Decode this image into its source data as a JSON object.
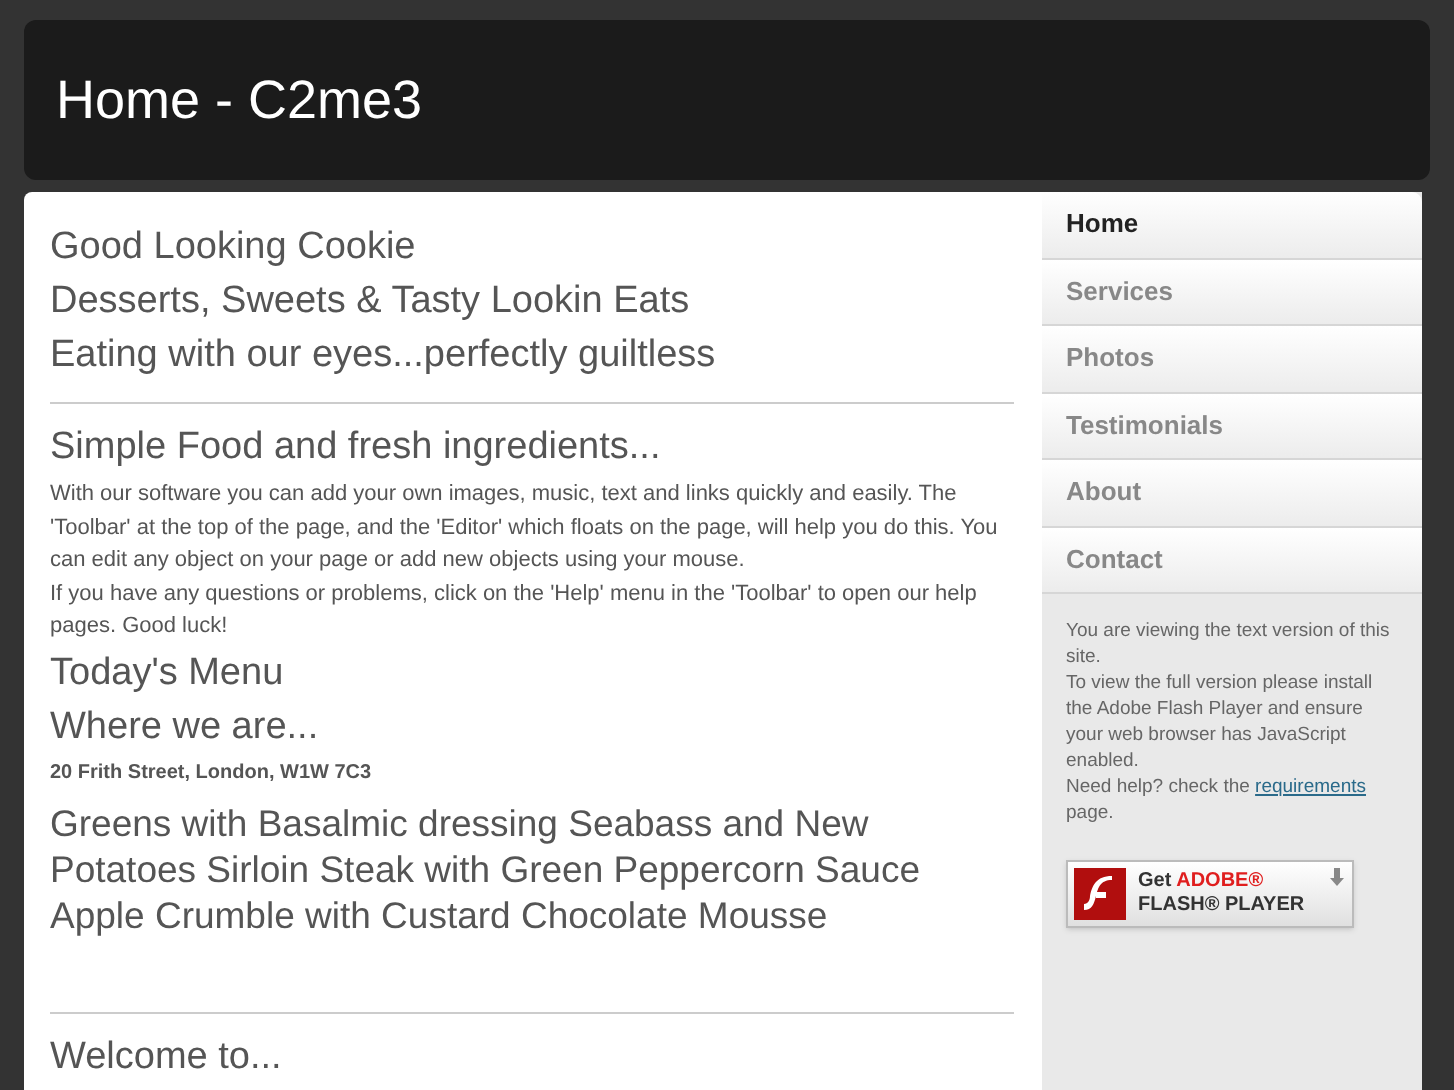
{
  "header": {
    "title": "Home - C2me3"
  },
  "content": {
    "intro_lines": [
      "Good Looking Cookie",
      "Desserts, Sweets & Tasty Lookin Eats",
      "Eating with our eyes...perfectly guiltless"
    ],
    "section_heading": "Simple Food and fresh ingredients...",
    "paragraphs": [
      "With our software you can add your own images, music, text and links quickly and easily. The 'Toolbar' at the top of the page, and the 'Editor' which floats on the page, will help you do this. You can edit any object on your page or add new objects using your mouse.",
      "If you have any questions or problems, click on the 'Help' menu in the 'Toolbar' to open our help pages. Good luck!"
    ],
    "menu_heading": "Today's Menu",
    "location_heading": "Where we are...",
    "address": "20 Frith Street, London, W1W 7C3",
    "menu_text": "Greens with Basalmic dressing Seabass and New Potatoes Sirloin Steak with Green Peppercorn Sauce Apple Crumble with Custard Chocolate Mousse",
    "welcome_heading": "Welcome to..."
  },
  "nav": [
    {
      "label": "Home",
      "selected": true
    },
    {
      "label": "Services",
      "selected": false
    },
    {
      "label": "Photos",
      "selected": false
    },
    {
      "label": "Testimonials",
      "selected": false
    },
    {
      "label": "About",
      "selected": false
    },
    {
      "label": "Contact",
      "selected": false
    }
  ],
  "sidebar": {
    "notice_lines": [
      "You are viewing the text version of this site.",
      "To view the full version please install the Adobe Flash Player and ensure your web browser has JavaScript enabled."
    ],
    "help": {
      "prefix": "Need help? check the",
      "link": "requirements",
      "suffix": "page."
    },
    "flash_badge": {
      "get": "Get",
      "brand": "ADOBE®",
      "product": "FLASH® PLAYER"
    }
  }
}
